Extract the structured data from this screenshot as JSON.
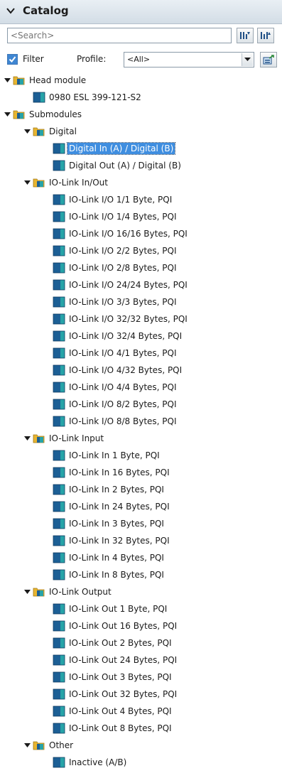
{
  "header": {
    "title": "Catalog",
    "collapse_icon": "chevron-down-icon"
  },
  "search": {
    "placeholder": "<Search>",
    "value": "",
    "search_down_icon": "search-down-icon",
    "search_up_icon": "search-up-icon"
  },
  "filter": {
    "label": "Filter",
    "checked": true,
    "profile_label": "Profile:",
    "profile_value": "<All>",
    "export_icon": "open-profile-icon"
  },
  "colors": {
    "header_top": "#e9eff4",
    "header_bottom": "#d3dde6",
    "selection": "#3f8ee0",
    "folder": "#e8b530",
    "module_blue": "#1c5f95",
    "module_teal": "#27a3a8"
  },
  "tree": [
    {
      "id": "head-module",
      "depth": 0,
      "type": "folder",
      "expanded": true,
      "label": "Head module"
    },
    {
      "id": "item",
      "depth": 1,
      "type": "module",
      "label": "0980 ESL 399-121-S2"
    },
    {
      "id": "submodules",
      "depth": 0,
      "type": "folder",
      "expanded": true,
      "label": "Submodules"
    },
    {
      "id": "digital",
      "depth": 1,
      "type": "folder",
      "expanded": true,
      "label": "Digital"
    },
    {
      "id": "item",
      "depth": 2,
      "type": "module",
      "selected": true,
      "label": "Digital In (A) / Digital (B)"
    },
    {
      "id": "item",
      "depth": 2,
      "type": "module",
      "label": "Digital Out (A) / Digital (B)"
    },
    {
      "id": "io-link-in-out",
      "depth": 1,
      "type": "folder",
      "expanded": true,
      "label": "IO-Link In/Out"
    },
    {
      "id": "item",
      "depth": 2,
      "type": "module",
      "label": "IO-Link I/O 1/1 Byte, PQI"
    },
    {
      "id": "item",
      "depth": 2,
      "type": "module",
      "label": "IO-Link I/O 1/4 Bytes, PQI"
    },
    {
      "id": "item",
      "depth": 2,
      "type": "module",
      "label": "IO-Link I/O 16/16 Bytes, PQI"
    },
    {
      "id": "item",
      "depth": 2,
      "type": "module",
      "label": "IO-Link I/O 2/2 Bytes, PQI"
    },
    {
      "id": "item",
      "depth": 2,
      "type": "module",
      "label": "IO-Link I/O 2/8 Bytes, PQI"
    },
    {
      "id": "item",
      "depth": 2,
      "type": "module",
      "label": "IO-Link I/O 24/24 Bytes, PQI"
    },
    {
      "id": "item",
      "depth": 2,
      "type": "module",
      "label": "IO-Link I/O 3/3 Bytes, PQI"
    },
    {
      "id": "item",
      "depth": 2,
      "type": "module",
      "label": "IO-Link I/O 32/32 Bytes, PQI"
    },
    {
      "id": "item",
      "depth": 2,
      "type": "module",
      "label": "IO-Link I/O 32/4 Bytes, PQI"
    },
    {
      "id": "item",
      "depth": 2,
      "type": "module",
      "label": "IO-Link I/O 4/1 Bytes, PQI"
    },
    {
      "id": "item",
      "depth": 2,
      "type": "module",
      "label": "IO-Link I/O 4/32 Bytes, PQI"
    },
    {
      "id": "item",
      "depth": 2,
      "type": "module",
      "label": "IO-Link I/O 4/4 Bytes, PQI"
    },
    {
      "id": "item",
      "depth": 2,
      "type": "module",
      "label": "IO-Link I/O 8/2 Bytes, PQI"
    },
    {
      "id": "item",
      "depth": 2,
      "type": "module",
      "label": "IO-Link I/O 8/8 Bytes, PQI"
    },
    {
      "id": "io-link-input",
      "depth": 1,
      "type": "folder",
      "expanded": true,
      "label": "IO-Link Input"
    },
    {
      "id": "item",
      "depth": 2,
      "type": "module",
      "label": "IO-Link In 1 Byte, PQI"
    },
    {
      "id": "item",
      "depth": 2,
      "type": "module",
      "label": "IO-Link In 16 Bytes, PQI"
    },
    {
      "id": "item",
      "depth": 2,
      "type": "module",
      "label": "IO-Link In 2 Bytes, PQI"
    },
    {
      "id": "item",
      "depth": 2,
      "type": "module",
      "label": "IO-Link In 24 Bytes, PQI"
    },
    {
      "id": "item",
      "depth": 2,
      "type": "module",
      "label": "IO-Link In 3 Bytes, PQI"
    },
    {
      "id": "item",
      "depth": 2,
      "type": "module",
      "label": "IO-Link In 32 Bytes, PQI"
    },
    {
      "id": "item",
      "depth": 2,
      "type": "module",
      "label": "IO-Link In 4 Bytes, PQI"
    },
    {
      "id": "item",
      "depth": 2,
      "type": "module",
      "label": "IO-Link In 8 Bytes, PQI"
    },
    {
      "id": "io-link-output",
      "depth": 1,
      "type": "folder",
      "expanded": true,
      "label": "IO-Link Output"
    },
    {
      "id": "item",
      "depth": 2,
      "type": "module",
      "label": "IO-Link Out 1 Byte, PQI"
    },
    {
      "id": "item",
      "depth": 2,
      "type": "module",
      "label": "IO-Link Out 16 Bytes, PQI"
    },
    {
      "id": "item",
      "depth": 2,
      "type": "module",
      "label": "IO-Link Out 2 Bytes, PQI"
    },
    {
      "id": "item",
      "depth": 2,
      "type": "module",
      "label": "IO-Link Out 24 Bytes, PQI"
    },
    {
      "id": "item",
      "depth": 2,
      "type": "module",
      "label": "IO-Link Out 3 Bytes, PQI"
    },
    {
      "id": "item",
      "depth": 2,
      "type": "module",
      "label": "IO-Link Out 32 Bytes, PQI"
    },
    {
      "id": "item",
      "depth": 2,
      "type": "module",
      "label": "IO-Link Out 4 Bytes, PQI"
    },
    {
      "id": "item",
      "depth": 2,
      "type": "module",
      "label": "IO-Link Out 8 Bytes, PQI"
    },
    {
      "id": "other",
      "depth": 1,
      "type": "folder",
      "expanded": true,
      "label": "Other"
    },
    {
      "id": "item",
      "depth": 2,
      "type": "module",
      "label": "Inactive (A/B)"
    }
  ]
}
